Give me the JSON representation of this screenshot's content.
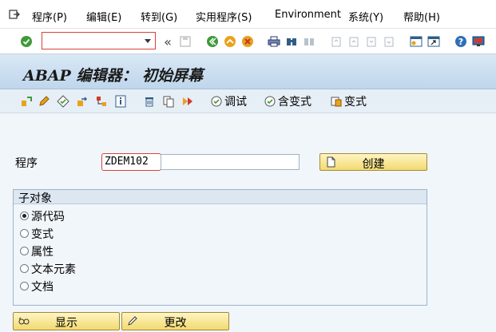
{
  "menubar": {
    "items": [
      "程序(P)",
      "编辑(E)",
      "转到(G)",
      "实用程序(S)",
      "Environment",
      "系统(Y)",
      "帮助(H)"
    ]
  },
  "toolbar": {
    "command_value": ""
  },
  "title_bar": {
    "title": "ABAP 编辑器： 初始屏幕"
  },
  "app_toolbar": {
    "debug_label": "调试",
    "with_variant_label": "含变式",
    "variant_label": "变式"
  },
  "form": {
    "program_label": "程序",
    "program_value": "ZDEM102",
    "create_label": "创建"
  },
  "subobjects": {
    "title": "子对象",
    "options": [
      "源代码",
      "变式",
      "属性",
      "文本元素",
      "文档"
    ],
    "selected_index": 0
  },
  "actions": {
    "display_label": "显示",
    "change_label": "更改"
  },
  "colors": {
    "focus_border": "#d9423a",
    "button_yellow": "#f2da70",
    "title_bg": "#bfd6ec"
  }
}
